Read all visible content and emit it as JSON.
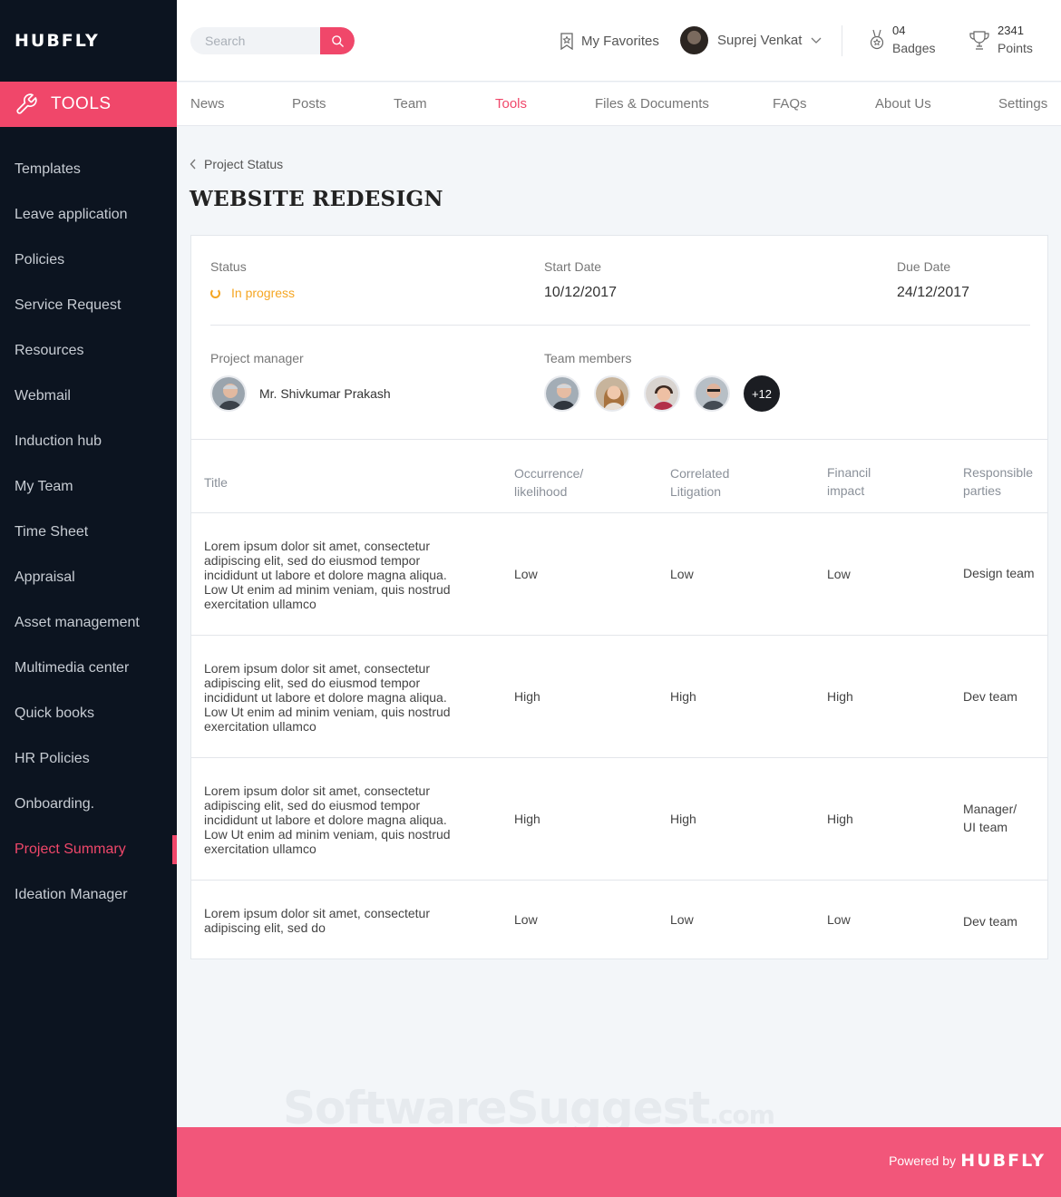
{
  "brand": {
    "logo": "HUBFLY",
    "accent": "#f0476a"
  },
  "sidebar": {
    "section": {
      "label": "TOOLS",
      "icon": "wrench-icon"
    },
    "items": [
      {
        "label": "Templates"
      },
      {
        "label": "Leave application"
      },
      {
        "label": "Policies"
      },
      {
        "label": "Service Request"
      },
      {
        "label": "Resources"
      },
      {
        "label": "Webmail"
      },
      {
        "label": "Induction hub"
      },
      {
        "label": "My Team"
      },
      {
        "label": "Time Sheet"
      },
      {
        "label": "Appraisal"
      },
      {
        "label": "Asset management"
      },
      {
        "label": "Multimedia center"
      },
      {
        "label": "Quick books"
      },
      {
        "label": "HR Policies"
      },
      {
        "label": "Onboarding."
      },
      {
        "label": "Project Summary",
        "active": true
      },
      {
        "label": "Ideation Manager"
      }
    ]
  },
  "header": {
    "search": {
      "placeholder": "Search"
    },
    "favorites_label": "My Favorites",
    "user_name": "Suprej Venkat",
    "badges": {
      "count": "04",
      "label": "Badges"
    },
    "points": {
      "count": "2341",
      "label": "Points"
    }
  },
  "nav": {
    "tabs": [
      {
        "label": "News"
      },
      {
        "label": "Posts"
      },
      {
        "label": "Team"
      },
      {
        "label": "Tools",
        "active": true
      },
      {
        "label": "Files & Documents"
      },
      {
        "label": "FAQs"
      },
      {
        "label": "About Us"
      },
      {
        "label": "Settings"
      }
    ]
  },
  "page": {
    "breadcrumb": "Project Status",
    "title": "WEBSITE REDESIGN"
  },
  "project": {
    "status_label": "Status",
    "status_value": "In progress",
    "status_color": "#f5a623",
    "start_label": "Start Date",
    "start_value": "10/12/2017",
    "due_label": "Due Date",
    "due_value": "24/12/2017",
    "manager_label": "Project manager",
    "manager_name": "Mr. Shivkumar Prakash",
    "team_label": "Team members",
    "team_more": "+12"
  },
  "table": {
    "headers": {
      "title": "Title",
      "occurrence": "Occurrence/\nlikelihood",
      "litigation": "Correlated\nLitigation",
      "financial": "Financil\nimpact",
      "responsible": "Responsible\nparties"
    },
    "rows": [
      {
        "title": "Lorem ipsum dolor sit amet, consectetur adipiscing elit, sed do eiusmod tempor incididunt ut labore et dolore magna aliqua. Low Ut enim ad minim veniam, quis nostrud exercitation ullamco",
        "occurrence": "Low",
        "litigation": "Low",
        "financial": "Low",
        "responsible": "Design team"
      },
      {
        "title": "Lorem ipsum dolor sit amet, consectetur adipiscing elit, sed do eiusmod tempor incididunt ut labore et dolore magna aliqua. Low Ut enim ad minim veniam, quis nostrud exercitation ullamco",
        "occurrence": "High",
        "litigation": "High",
        "financial": "High",
        "responsible": "Dev team"
      },
      {
        "title": "Lorem ipsum dolor sit amet, consectetur adipiscing elit, sed do eiusmod tempor incididunt ut labore et dolore magna aliqua. Low Ut enim ad minim veniam, quis nostrud exercitation ullamco",
        "occurrence": "High",
        "litigation": "High",
        "financial": "High",
        "responsible": "Manager/\nUI team"
      },
      {
        "title": "Lorem ipsum dolor sit amet, consectetur adipiscing elit, sed do",
        "occurrence": "Low",
        "litigation": "Low",
        "financial": "Low",
        "responsible": "Dev team"
      }
    ]
  },
  "footer": {
    "powered_by": "Powered by",
    "logo": "HUBFLY"
  },
  "watermark": {
    "text": "SoftwareSuggest",
    "suffix": ".com"
  }
}
